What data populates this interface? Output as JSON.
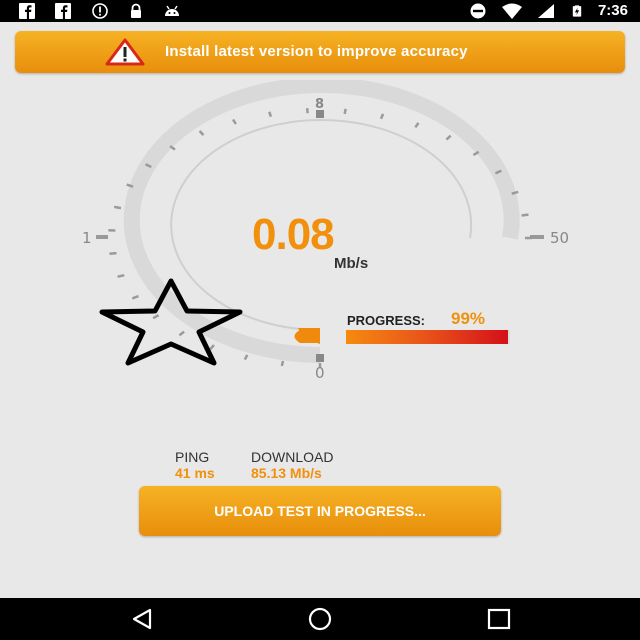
{
  "status_bar": {
    "icons": [
      "facebook-icon",
      "facebook-icon",
      "alert-icon",
      "lock-icon",
      "android-icon"
    ],
    "right_icons": [
      "do-not-disturb-icon",
      "wifi-icon",
      "signal-icon",
      "battery-charging-icon"
    ],
    "time": "7:36"
  },
  "banner": {
    "icon": "warning-icon",
    "text": "Install latest version to improve accuracy"
  },
  "gauge": {
    "value": "0.08",
    "unit": "Mb/s",
    "labels": {
      "top": "8",
      "left": "1",
      "right": "50",
      "bottom": "0"
    },
    "progress_label": "PROGRESS:",
    "progress_value": "99%",
    "progress_fraction": 0.99
  },
  "metrics": {
    "ping_label": "PING",
    "ping_value": "41 ms",
    "download_label": "DOWNLOAD",
    "download_value": "85.13 Mb/s"
  },
  "action_button": {
    "label": "UPLOAD TEST IN PROGRESS..."
  },
  "nav": {
    "icons": [
      "back-icon",
      "home-icon",
      "recents-icon"
    ]
  },
  "colors": {
    "accent": "#f0900c",
    "banner": "#f2a41c",
    "progress_end": "#d4101a"
  }
}
